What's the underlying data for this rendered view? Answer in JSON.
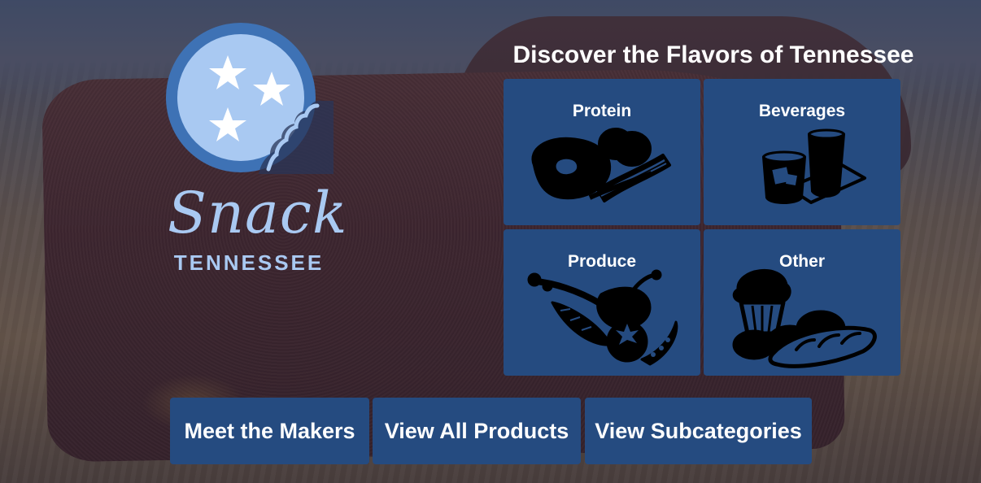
{
  "logo": {
    "wordmark": "Snack",
    "subtitle": "TENNESSEE"
  },
  "heading": "Discover the Flavors of Tennessee",
  "categories": [
    {
      "label": "Protein",
      "icon": "meat-bacon-icon"
    },
    {
      "label": "Beverages",
      "icon": "drinks-icon"
    },
    {
      "label": "Produce",
      "icon": "vegetables-icon"
    },
    {
      "label": "Other",
      "icon": "baked-goods-icon"
    }
  ],
  "buttons": {
    "makers": "Meet the Makers",
    "products": "View All Products",
    "subcategories": "View Subcategories"
  },
  "colors": {
    "tile_bg": "#254b80",
    "logo_light": "#a9c9f2",
    "logo_dark": "#3e72b5",
    "text": "#ffffff",
    "icon": "#000000"
  }
}
